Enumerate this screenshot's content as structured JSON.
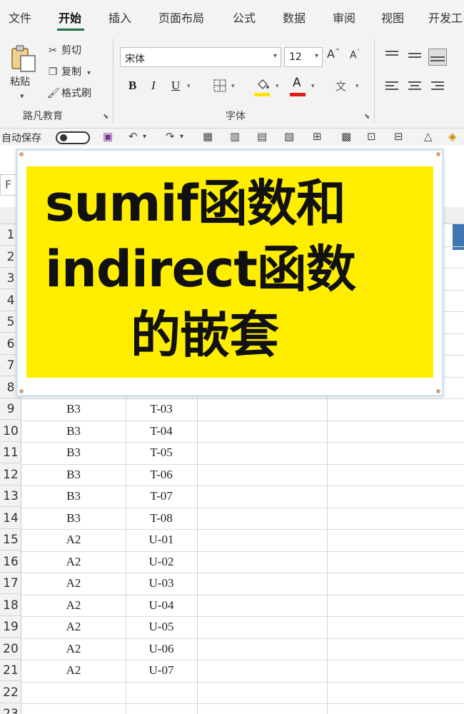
{
  "menu": {
    "tabs": [
      "文件",
      "开始",
      "插入",
      "页面布局",
      "公式",
      "数据",
      "审阅",
      "视图",
      "开发工"
    ],
    "active": "开始"
  },
  "ribbon": {
    "clipboard": {
      "paste_label": "粘贴",
      "cut_label": "剪切",
      "copy_label": "复制",
      "format_painter_label": "格式刷",
      "group_label": "路凡教育"
    },
    "font": {
      "font_name": "宋体",
      "font_size": "12",
      "group_label": "字体",
      "bold": "B",
      "italic": "I",
      "underline": "U",
      "grow": "A",
      "shrink": "A",
      "font_color_glyph": "A",
      "phonetic_glyph": "文"
    }
  },
  "quick_access": {
    "autosave_label": "自动保存"
  },
  "sheet": {
    "namebox_fragment": "F",
    "row_numbers": [
      "1",
      "2",
      "3",
      "4",
      "5",
      "6",
      "7",
      "8",
      "9",
      "10",
      "11",
      "12",
      "13",
      "14",
      "15",
      "16",
      "17",
      "18",
      "19",
      "20",
      "21",
      "22",
      "23"
    ],
    "rows": [
      {
        "row": "9",
        "col_a": "B3",
        "col_b": "T-03"
      },
      {
        "row": "10",
        "col_a": "B3",
        "col_b": "T-04"
      },
      {
        "row": "11",
        "col_a": "B3",
        "col_b": "T-05"
      },
      {
        "row": "12",
        "col_a": "B3",
        "col_b": "T-06"
      },
      {
        "row": "13",
        "col_a": "B3",
        "col_b": "T-07"
      },
      {
        "row": "14",
        "col_a": "B3",
        "col_b": "T-08"
      },
      {
        "row": "15",
        "col_a": "A2",
        "col_b": "U-01"
      },
      {
        "row": "16",
        "col_a": "A2",
        "col_b": "U-02"
      },
      {
        "row": "17",
        "col_a": "A2",
        "col_b": "U-03"
      },
      {
        "row": "18",
        "col_a": "A2",
        "col_b": "U-04"
      },
      {
        "row": "19",
        "col_a": "A2",
        "col_b": "U-05"
      },
      {
        "row": "20",
        "col_a": "A2",
        "col_b": "U-06"
      },
      {
        "row": "21",
        "col_a": "A2",
        "col_b": "U-07"
      }
    ]
  },
  "overlay": {
    "title_lines": [
      "sumif函数和",
      "indirect函数",
      "的嵌套"
    ],
    "background_color": "#ffee00"
  },
  "colors": {
    "accent_green": "#1e7145",
    "highlight_yellow": "#ffe600",
    "font_red": "#e01b1b",
    "selection_blue": "#3f77b4"
  }
}
